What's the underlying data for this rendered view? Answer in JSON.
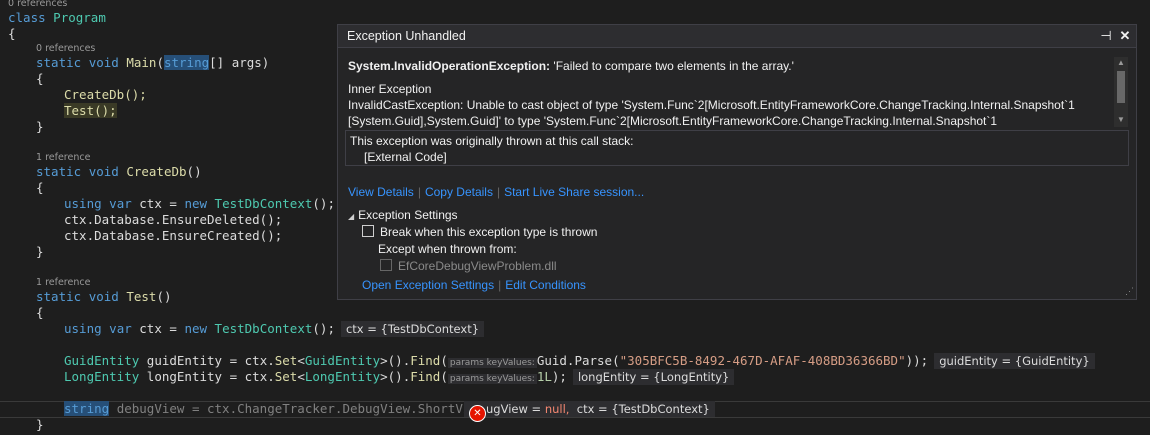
{
  "editor": {
    "refs": {
      "class_refs": "0 references",
      "main_refs": "0 references",
      "createdb_refs": "1 reference",
      "test_refs": "1 reference"
    },
    "class_kw": "class",
    "class_name": "Program",
    "open_brace": "{",
    "close_brace": "}",
    "main_sig": {
      "static": "static",
      "void": "void",
      "name": "Main",
      "type": "string",
      "rest": "[] args)"
    },
    "createdb_call": "CreateDb();",
    "test_call": "Test();",
    "createdb_sig": {
      "static": "static",
      "void": "void",
      "name": "CreateDb",
      "rest": "()"
    },
    "using_kw": "using",
    "var_kw": "var",
    "new_kw": "new",
    "ctx_type": "TestDbContext",
    "ensure_deleted": "ctx.Database.EnsureDeleted();",
    "ensure_created": "ctx.Database.EnsureCreated();",
    "test_sig": {
      "static": "static",
      "void": "void",
      "name": "Test",
      "rest": "()"
    },
    "ctx_datatip": "ctx = {TestDbContext}",
    "guid_type": "GuidEntity",
    "guid_var": "guidEntity",
    "long_type": "LongEntity",
    "long_var": "longEntity",
    "param_hint": "params keyValues:",
    "guid_parse": "Guid.Parse(",
    "guid_string": "\"305BFC5B-8492-467D-AFAF-408BD36366BD\"",
    "guid_datatip": "guidEntity = {GuidEntity}",
    "long_value": "1L",
    "long_datatip": "longEntity = {LongEntity}",
    "string_kw": "string",
    "debug_line": "debugView = ctx.ChangeTracker.DebugView.ShortView;",
    "debug_datatip_1": "ugView = ",
    "debug_null": "null,",
    "debug_datatip_2": "ctx = {TestDbContext}"
  },
  "dialog": {
    "title": "Exception Unhandled",
    "pin_icon": "pin-icon",
    "close_icon": "close-icon",
    "exception_type": "System.InvalidOperationException:",
    "exception_message": "'Failed to compare two elements in the array.'",
    "inner_header": "Inner Exception",
    "inner_line1": "InvalidCastException: Unable to cast object of type 'System.Func`2[Microsoft.EntityFrameworkCore.ChangeTracking.Internal.Snapshot`1",
    "inner_line2": "[System.Guid],System.Guid]' to type 'System.Func`2[Microsoft.EntityFrameworkCore.ChangeTracking.Internal.Snapshot`1",
    "stack_header": "This exception was originally thrown at this call stack:",
    "stack_item": "[External Code]",
    "links": [
      "View Details",
      "Copy Details",
      "Start Live Share session..."
    ],
    "settings_header": "Exception Settings",
    "break_label": "Break when this exception type is thrown",
    "except_label": "Except when thrown from:",
    "dll_label": "EfCoreDebugViewProblem.dll",
    "bottom_links": [
      "Open Exception Settings",
      "Edit Conditions"
    ],
    "link_color": "#3794ff"
  }
}
